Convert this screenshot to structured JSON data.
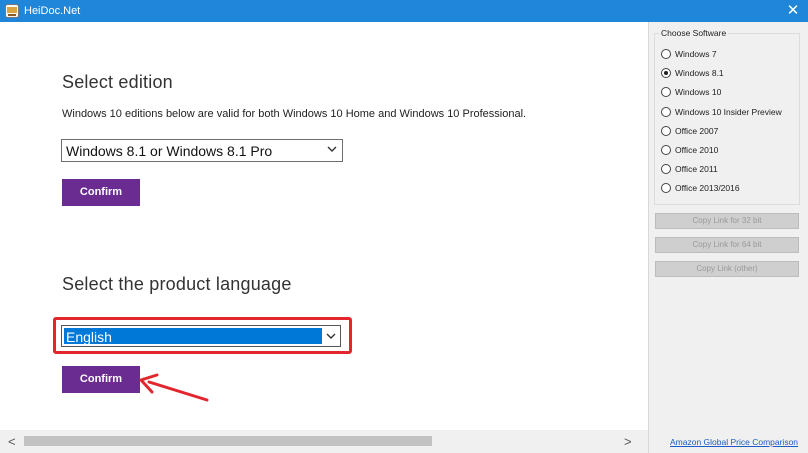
{
  "window": {
    "title": "HeiDoc.Net",
    "close_glyph": "✕"
  },
  "main": {
    "edition_heading": "Select edition",
    "edition_description": "Windows 10 editions below are valid for both Windows 10 Home and Windows 10 Professional.",
    "edition_select_value": "Windows 8.1 or Windows 8.1 Pro",
    "confirm_label_1": "Confirm",
    "language_heading": "Select the product language",
    "language_select_value": "English",
    "confirm_label_2": "Confirm"
  },
  "scrollbar": {
    "left_glyph": "<",
    "right_glyph": ">"
  },
  "sidebar": {
    "group_label": "Choose Software",
    "options": [
      {
        "label": "Windows 7",
        "checked": false
      },
      {
        "label": "Windows 8.1",
        "checked": true
      },
      {
        "label": "Windows 10",
        "checked": false
      },
      {
        "label": "Windows 10 Insider Preview",
        "checked": false
      },
      {
        "label": "Office 2007",
        "checked": false
      },
      {
        "label": "Office 2010",
        "checked": false
      },
      {
        "label": "Office 2011",
        "checked": false
      },
      {
        "label": "Office 2013/2016",
        "checked": false
      }
    ],
    "copy_32": "Copy Link for 32 bit",
    "copy_64": "Copy Link for 64 bit",
    "copy_other": "Copy Link (other)",
    "amazon_link": "Amazon Global Price Comparison"
  },
  "colors": {
    "titlebar": "#1f86d9",
    "confirm": "#6a2c91",
    "highlight": "#e3262d",
    "selection": "#0078d7"
  }
}
